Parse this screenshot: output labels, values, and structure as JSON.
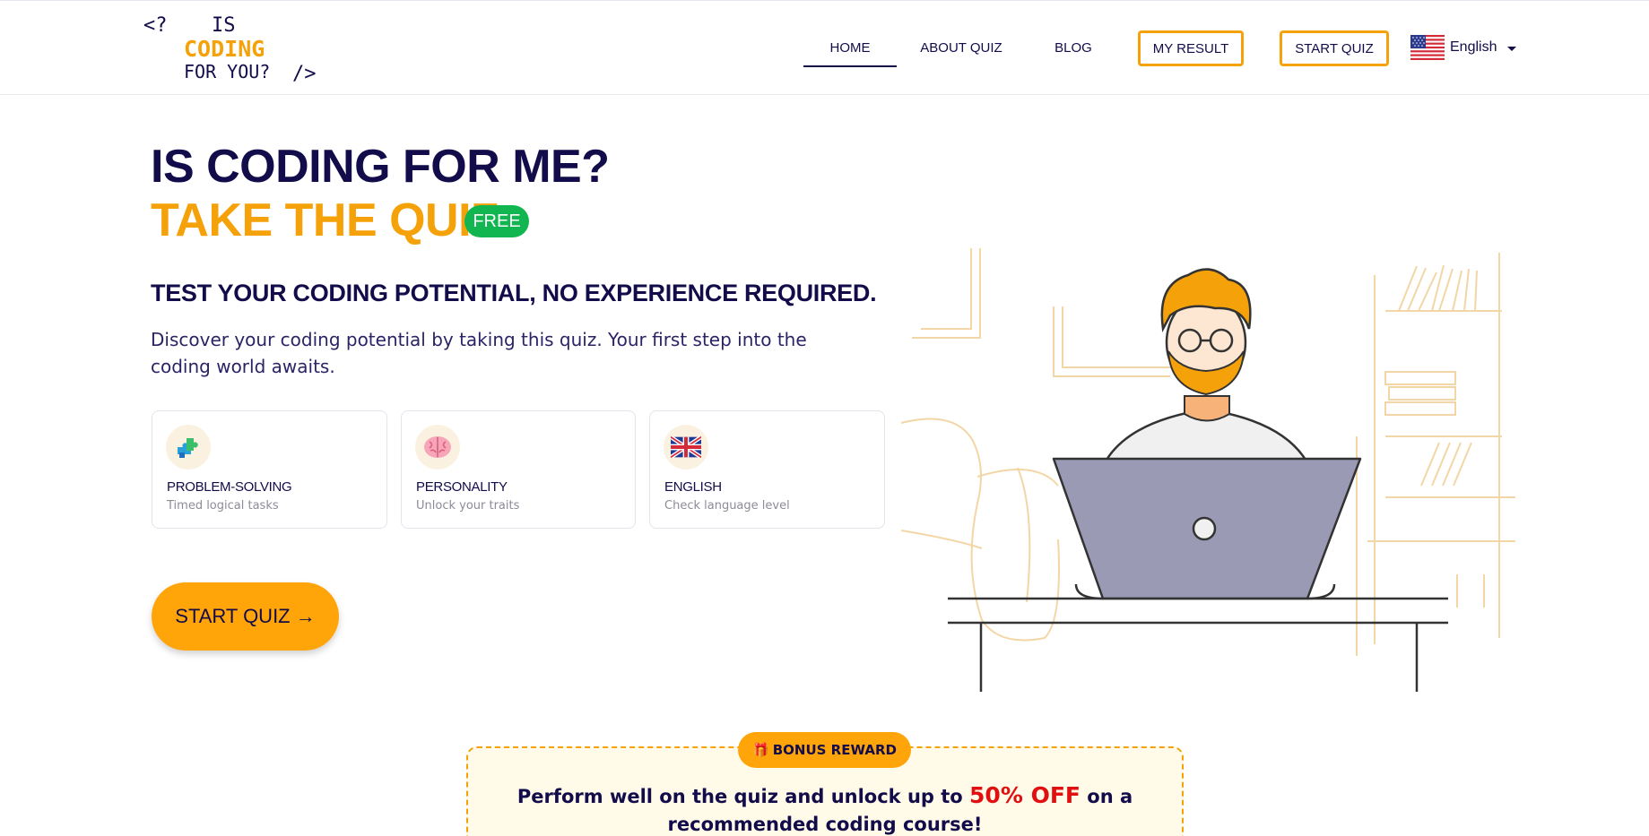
{
  "logo": {
    "open_tag": "<?",
    "word_is": "IS",
    "word_coding": "CODING",
    "word_for_you": "FOR YOU?",
    "close_tag": "/>"
  },
  "nav": {
    "home": "HOME",
    "about": "ABOUT QUIZ",
    "blog": "BLOG",
    "my_result": "MY RESULT",
    "start_quiz": "START QUIZ",
    "language": "English"
  },
  "hero": {
    "title": "IS CODING FOR ME?",
    "subtitle": "TAKE THE QUIZ",
    "badge": "FREE",
    "tagline": "TEST YOUR CODING POTENTIAL, NO EXPERIENCE REQUIRED.",
    "description": "Discover your coding potential by taking this quiz. Your first step into the coding world awaits."
  },
  "features": [
    {
      "icon": "puzzle-icon",
      "title": "PROBLEM-SOLVING",
      "subtitle": "Timed logical tasks"
    },
    {
      "icon": "brain-icon",
      "title": "PERSONALITY",
      "subtitle": "Unlock your traits"
    },
    {
      "icon": "uk-flag-icon",
      "title": "ENGLISH",
      "subtitle": "Check language level"
    }
  ],
  "cta": {
    "label": "START QUIZ →"
  },
  "bonus": {
    "badge": "BONUS REWARD",
    "text_before": "Perform well on the quiz and unlock up to ",
    "highlight": "50% OFF",
    "text_after": " on a recommended coding course!"
  },
  "colors": {
    "navy": "#120c4a",
    "orange": "#f5a20a",
    "green": "#12b650",
    "red": "#e01010"
  }
}
